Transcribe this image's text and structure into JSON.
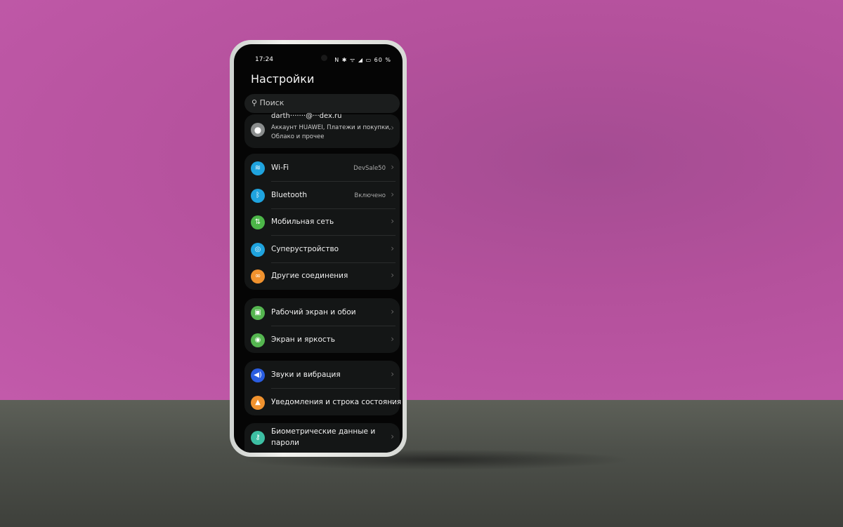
{
  "status": {
    "time": "17:24",
    "icons": "N ✱ ᯤ ◢ ▭",
    "battery": "60 %"
  },
  "header": {
    "title": "Настройки"
  },
  "search": {
    "placeholder": "Поиск"
  },
  "account": {
    "name": "darth·······@···dex.ru",
    "subtitle_line1": "Аккаунт HUAWEI, Платежи и покупки,",
    "subtitle_line2": "Облако и прочее"
  },
  "groups": [
    [
      {
        "label": "Wi-Fi",
        "value": "DevSale50",
        "icon": "wifi-icon",
        "color": "#1fa3de"
      },
      {
        "label": "Bluetooth",
        "value": "Включено",
        "icon": "bluetooth-icon",
        "color": "#1fa3de"
      },
      {
        "label": "Мобильная сеть",
        "icon": "mobile-data-icon",
        "color": "#4cb648"
      },
      {
        "label": "Суперустройство",
        "icon": "super-device-icon",
        "color": "#1fa3de"
      },
      {
        "label": "Другие соединения",
        "icon": "link-icon",
        "color": "#f0922e"
      }
    ],
    [
      {
        "label": "Рабочий экран и обои",
        "icon": "wallpaper-icon",
        "color": "#55b650"
      },
      {
        "label": "Экран и яркость",
        "icon": "eye-icon",
        "color": "#55b650"
      }
    ],
    [
      {
        "label": "Звуки и вибрация",
        "icon": "speaker-icon",
        "color": "#2a5de0"
      },
      {
        "label": "Уведомления и строка состояния",
        "icon": "bell-icon",
        "color": "#f0922e"
      }
    ],
    [
      {
        "label": "Биометрические данные и",
        "label2": "пароли",
        "icon": "key-icon",
        "color": "#3dbfa3"
      }
    ]
  ]
}
